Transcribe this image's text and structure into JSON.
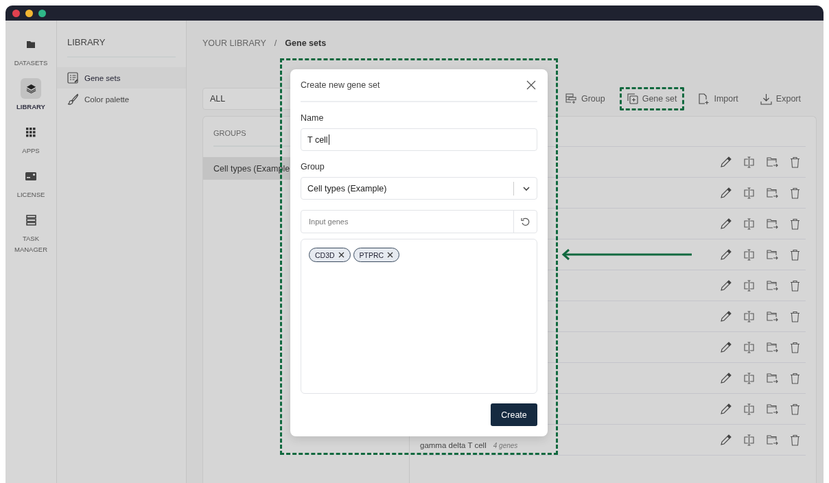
{
  "nav": [
    {
      "label": "DATASETS",
      "selected": false
    },
    {
      "label": "LIBRARY",
      "selected": true
    },
    {
      "label": "APPS",
      "selected": false
    },
    {
      "label": "LICENSE",
      "selected": false
    },
    {
      "label": "TASK MANAGER",
      "selected": false
    }
  ],
  "sidebar": {
    "title": "LIBRARY",
    "items": [
      {
        "label": "Gene sets",
        "selected": true
      },
      {
        "label": "Color palette",
        "selected": false
      }
    ]
  },
  "breadcrumb": {
    "root": "YOUR LIBRARY",
    "separator": "/",
    "current": "Gene sets"
  },
  "filter": {
    "value": "ALL"
  },
  "toolbar": [
    {
      "label": "Group",
      "highlighted": false
    },
    {
      "label": "Gene set",
      "highlighted": true
    },
    {
      "label": "Import",
      "highlighted": false
    },
    {
      "label": "Export",
      "highlighted": false
    }
  ],
  "groups": {
    "heading": "GROUPS",
    "items": [
      {
        "label": "Cell types (Example",
        "selected": true
      }
    ]
  },
  "gene_sets": {
    "rows": [
      {
        "kind": "covered"
      },
      {
        "kind": "covered"
      },
      {
        "kind": "covered"
      },
      {
        "kind": "covered"
      },
      {
        "kind": "covered"
      },
      {
        "kind": "covered"
      },
      {
        "kind": "covered"
      },
      {
        "kind": "covered"
      },
      {
        "kind": "covered"
      },
      {
        "kind": "labeled",
        "name": "gamma delta T cell",
        "count": "4 genes"
      }
    ]
  },
  "dialog": {
    "title": "Create new gene set",
    "highlighted": true,
    "name_label": "Name",
    "name_value": "T cell",
    "group_label": "Group",
    "group_value": "Cell types (Example)",
    "genes_placeholder": "Input genes",
    "tags": [
      "CD3D",
      "PTPRC"
    ],
    "submit": "Create"
  }
}
